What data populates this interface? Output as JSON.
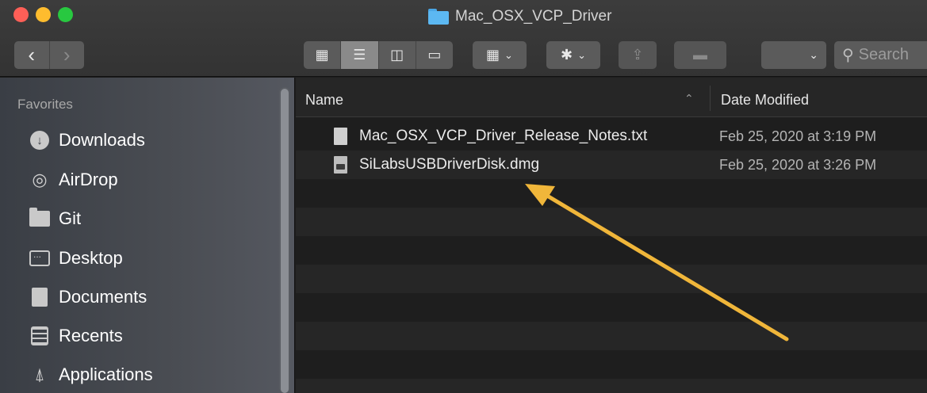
{
  "window": {
    "title": "Mac_OSX_VCP_Driver"
  },
  "toolbar": {
    "back_icon": "chevron-left-icon",
    "forward_icon": "chevron-right-icon",
    "view_icons": [
      "icon-view-icon",
      "list-view-icon",
      "column-view-icon",
      "gallery-view-icon"
    ],
    "active_view": "list",
    "group_icon": "group-grid-icon",
    "action_icon": "gear-icon",
    "share_icon": "share-icon",
    "tag_icon": "tag-icon",
    "search_placeholder": "Search"
  },
  "sidebar": {
    "section_label": "Favorites",
    "items": [
      {
        "label": "Downloads",
        "icon": "download-icon"
      },
      {
        "label": "AirDrop",
        "icon": "airdrop-icon"
      },
      {
        "label": "Git",
        "icon": "folder-icon"
      },
      {
        "label": "Desktop",
        "icon": "desktop-icon"
      },
      {
        "label": "Documents",
        "icon": "document-icon"
      },
      {
        "label": "Recents",
        "icon": "recents-icon"
      },
      {
        "label": "Applications",
        "icon": "applications-icon"
      }
    ]
  },
  "list": {
    "columns": {
      "name": "Name",
      "date": "Date Modified"
    },
    "files": [
      {
        "name": "Mac_OSX_VCP_Driver_Release_Notes.txt",
        "date": "Feb 25, 2020 at 3:19 PM",
        "icon": "text-file-icon"
      },
      {
        "name": "SiLabsUSBDriverDisk.dmg",
        "date": "Feb 25, 2020 at 3:26 PM",
        "icon": "disk-image-icon"
      }
    ]
  },
  "annotation": {
    "arrow_color": "#f0b63a"
  }
}
